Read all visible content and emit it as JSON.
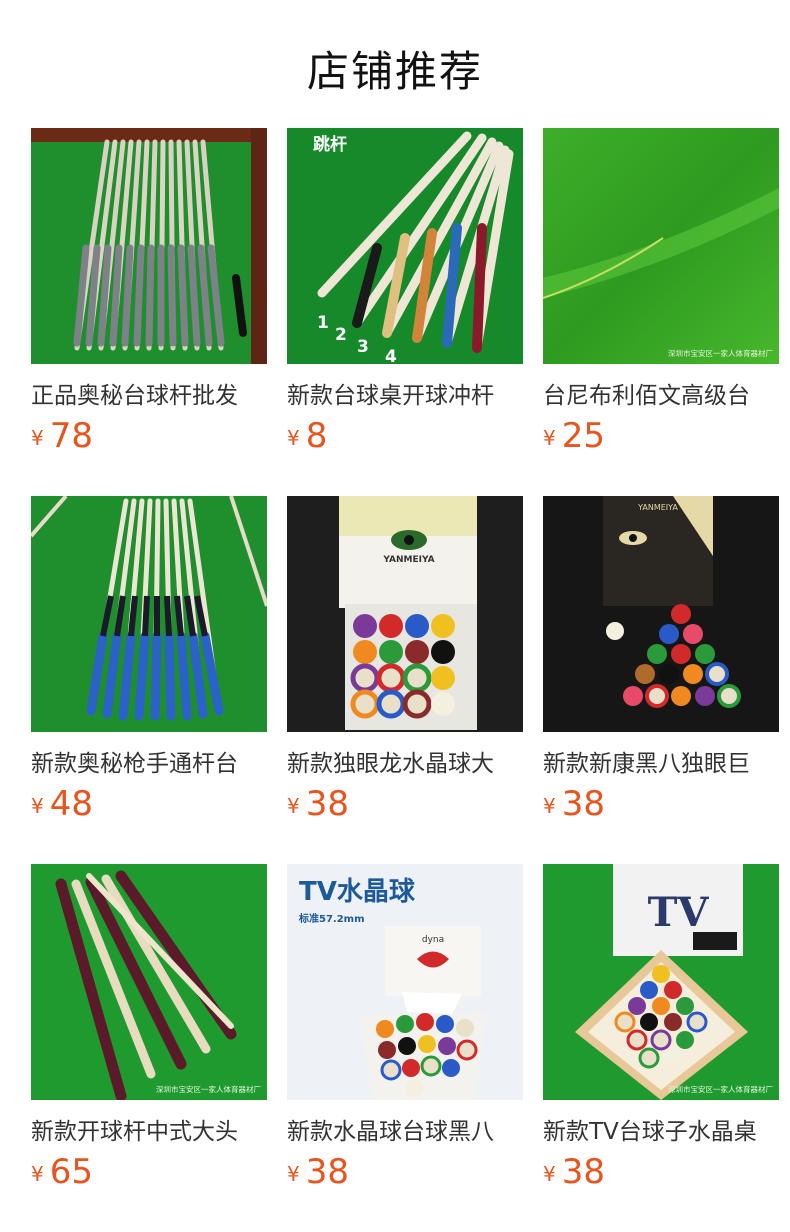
{
  "page": {
    "title": "店铺推荐"
  },
  "products": [
    {
      "name": "正品奥秘台球杆批发",
      "currency": "¥",
      "price": "78",
      "image_text": []
    },
    {
      "name": "新款台球桌开球冲杆",
      "currency": "¥",
      "price": "8",
      "image_text": [
        "跳杆",
        "1",
        "2",
        "3",
        "4"
      ]
    },
    {
      "name": "台尼布利佰文高级台",
      "currency": "¥",
      "price": "25",
      "image_text": [
        "深圳市宝安区一家人体育器材厂"
      ]
    },
    {
      "name": "新款奥秘枪手通杆台",
      "currency": "¥",
      "price": "48",
      "image_text": []
    },
    {
      "name": "新款独眼龙水晶球大",
      "currency": "¥",
      "price": "38",
      "image_text": [
        "YANMEIYA"
      ]
    },
    {
      "name": "新款新康黑八独眼巨",
      "currency": "¥",
      "price": "38",
      "image_text": [
        "YANMEIYA"
      ]
    },
    {
      "name": "新款开球杆中式大头",
      "currency": "¥",
      "price": "65",
      "image_text": [
        "深圳市宝安区一家人体育器材厂"
      ]
    },
    {
      "name": "新款水晶球台球黑八",
      "currency": "¥",
      "price": "38",
      "image_text": [
        "TV水晶球",
        "标准57.2mm",
        "dyna"
      ]
    },
    {
      "name": "新款TV台球子水晶桌",
      "currency": "¥",
      "price": "38",
      "image_text": [
        "TV",
        "深圳市宝安区一家人体育器材厂"
      ]
    }
  ],
  "colors": {
    "price": "#e8541c",
    "felt": "#1a8a2a"
  }
}
